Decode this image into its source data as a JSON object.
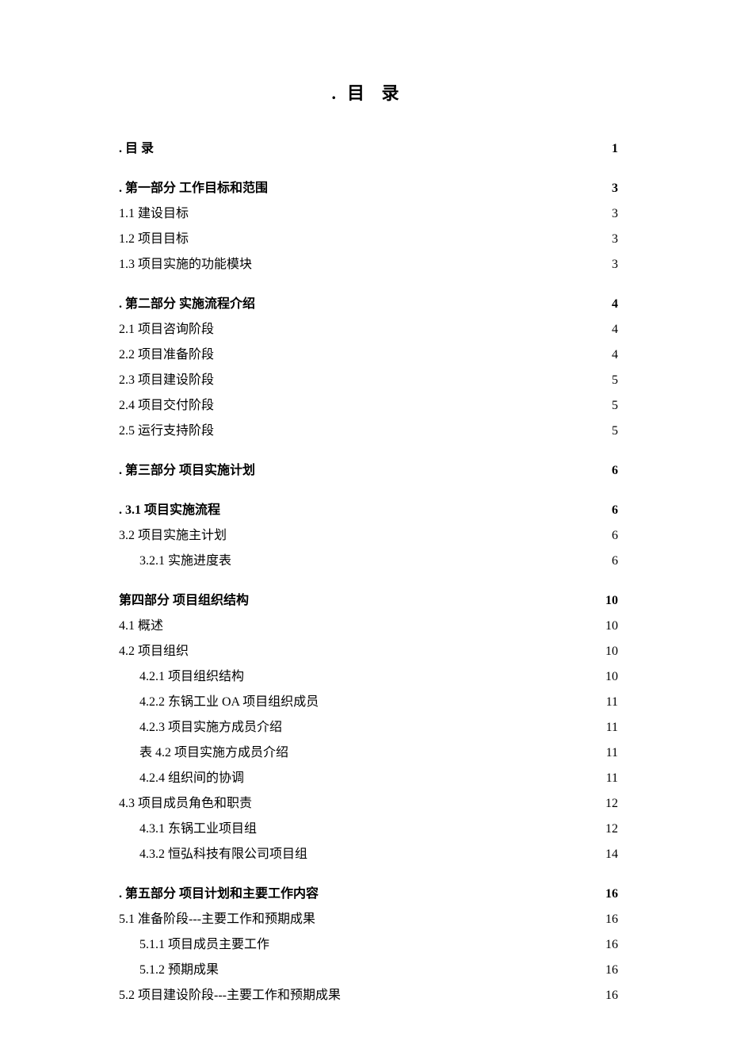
{
  "title_dot": "目",
  "title_rest": "录",
  "entries": [
    {
      "label": ".  目   录",
      "page": "1",
      "bold": true,
      "section": true,
      "indent": 0
    },
    {
      "label": ".  第一部分  工作目标和范围",
      "page": "3",
      "bold": true,
      "section": true,
      "indent": 0
    },
    {
      "label": "1.1 建设目标",
      "page": "3",
      "bold": false,
      "section": false,
      "indent": 0
    },
    {
      "label": "1.2 项目目标",
      "page": "3",
      "bold": false,
      "section": false,
      "indent": 0
    },
    {
      "label": "1.3 项目实施的功能模块",
      "page": "3",
      "bold": false,
      "section": false,
      "indent": 0
    },
    {
      "label": ".  第二部分  实施流程介绍",
      "page": "4",
      "bold": true,
      "section": true,
      "indent": 0
    },
    {
      "label": "2.1 项目咨询阶段",
      "page": "4",
      "bold": false,
      "section": false,
      "indent": 0
    },
    {
      "label": "2.2 项目准备阶段",
      "page": "4",
      "bold": false,
      "section": false,
      "indent": 0
    },
    {
      "label": "2.3 项目建设阶段",
      "page": "5",
      "bold": false,
      "section": false,
      "indent": 0
    },
    {
      "label": "2.4 项目交付阶段",
      "page": "5",
      "bold": false,
      "section": false,
      "indent": 0
    },
    {
      "label": "2.5 运行支持阶段",
      "page": "5",
      "bold": false,
      "section": false,
      "indent": 0
    },
    {
      "label": ".  第三部分  项目实施计划",
      "page": "6",
      "bold": true,
      "section": true,
      "indent": 0
    },
    {
      "label": ".  3.1 项目实施流程",
      "page": "6",
      "bold": true,
      "section": true,
      "indent": 0
    },
    {
      "label": "3.2 项目实施主计划",
      "page": "6",
      "bold": false,
      "section": false,
      "indent": 0
    },
    {
      "label": "3.2.1 实施进度表",
      "page": "6",
      "bold": false,
      "section": false,
      "indent": 1
    },
    {
      "label": "第四部分  项目组织结构",
      "page": "10",
      "bold": true,
      "section": true,
      "indent": 0
    },
    {
      "label": "4.1 概述",
      "page": "10",
      "bold": false,
      "section": false,
      "indent": 0
    },
    {
      "label": "4.2 项目组织",
      "page": "10",
      "bold": false,
      "section": false,
      "indent": 0
    },
    {
      "label": "4.2.1 项目组织结构",
      "page": "10",
      "bold": false,
      "section": false,
      "indent": 1
    },
    {
      "label": "4.2.2 东锅工业 OA 项目组织成员",
      "page": "11",
      "bold": false,
      "section": false,
      "indent": 1
    },
    {
      "label": "4.2.3 项目实施方成员介绍",
      "page": "11",
      "bold": false,
      "section": false,
      "indent": 1
    },
    {
      "label": "表 4.2 项目实施方成员介绍",
      "page": "11",
      "bold": false,
      "section": false,
      "indent": 1
    },
    {
      "label": "4.2.4 组织间的协调",
      "page": "11",
      "bold": false,
      "section": false,
      "indent": 1
    },
    {
      "label": "4.3 项目成员角色和职责",
      "page": "12",
      "bold": false,
      "section": false,
      "indent": 0
    },
    {
      "label": "4.3.1 东锅工业项目组",
      "page": "12",
      "bold": false,
      "section": false,
      "indent": 1
    },
    {
      "label": "4.3.2 恒弘科技有限公司项目组",
      "page": "14",
      "bold": false,
      "section": false,
      "indent": 1
    },
    {
      "label": ".  第五部分  项目计划和主要工作内容",
      "page": "16",
      "bold": true,
      "section": true,
      "indent": 0
    },
    {
      "label": "5.1 准备阶段---主要工作和预期成果",
      "page": "16",
      "bold": false,
      "section": false,
      "indent": 0
    },
    {
      "label": "5.1.1 项目成员主要工作",
      "page": "16",
      "bold": false,
      "section": false,
      "indent": 1
    },
    {
      "label": "5.1.2 预期成果",
      "page": "16",
      "bold": false,
      "section": false,
      "indent": 1
    },
    {
      "label": "5.2 项目建设阶段---主要工作和预期成果",
      "page": "16",
      "bold": false,
      "section": false,
      "indent": 0
    }
  ]
}
